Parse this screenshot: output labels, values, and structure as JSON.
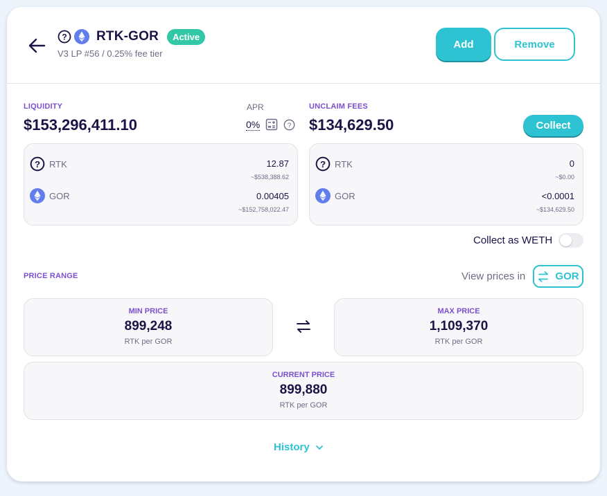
{
  "header": {
    "pair": "RTK-GOR",
    "status_badge": "Active",
    "subtitle": "V3 LP #56 / 0.25% fee tier",
    "add_label": "Add",
    "remove_label": "Remove"
  },
  "liquidity": {
    "label": "LIQUIDITY",
    "amount": "$153,296,411.10",
    "apr_label": "APR",
    "apr_value": "0%",
    "tokens": [
      {
        "symbol": "RTK",
        "icon": "question-icon",
        "amount": "12.87",
        "usd": "~$538,388.62"
      },
      {
        "symbol": "GOR",
        "icon": "eth-icon",
        "amount": "0.00405",
        "usd": "~$152,758,022.47"
      }
    ]
  },
  "fees": {
    "label": "UNCLAIM FEES",
    "amount": "$134,629.50",
    "collect_label": "Collect",
    "tokens": [
      {
        "symbol": "RTK",
        "icon": "question-icon",
        "amount": "0",
        "usd": "~$0.00"
      },
      {
        "symbol": "GOR",
        "icon": "eth-icon",
        "amount": "<0.0001",
        "usd": "~$134,629.50"
      }
    ],
    "collect_as_weth_label": "Collect as WETH"
  },
  "price_range": {
    "label": "PRICE RANGE",
    "view_prices_label": "View prices in",
    "unit_token": "GOR",
    "min": {
      "label": "MIN PRICE",
      "value": "899,248",
      "unit": "RTK per GOR"
    },
    "max": {
      "label": "MAX PRICE",
      "value": "1,109,370",
      "unit": "RTK per GOR"
    },
    "current": {
      "label": "CURRENT PRICE",
      "value": "899,880",
      "unit": "RTK per GOR"
    }
  },
  "history_label": "History",
  "colors": {
    "accent": "#2ec3d3",
    "purple_label": "#7a4fd0",
    "active_badge": "#32c7a7",
    "eth_icon": "#627eea"
  }
}
